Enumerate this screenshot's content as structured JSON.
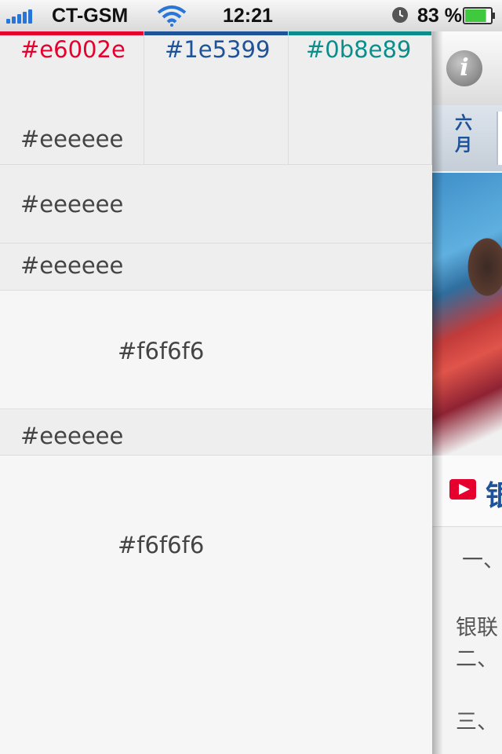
{
  "status_bar": {
    "carrier": "CT-GSM",
    "time": "12:21",
    "battery_percent": "83 %",
    "signal_bars": 5,
    "battery_level": 0.83
  },
  "menu": {
    "swatches": [
      {
        "label": "#e6002e",
        "color": "#e6002e"
      },
      {
        "label": "#1e5399",
        "color": "#1e5399"
      },
      {
        "label": "#0b8e89",
        "color": "#0b8e89"
      }
    ],
    "swatch_sub_label": "#eeeeee",
    "rows": [
      {
        "label": "#eeeeee"
      },
      {
        "label": "#eeeeee"
      },
      {
        "label": "#f6f6f6"
      },
      {
        "label": "#eeeeee"
      },
      {
        "label": "#f6f6f6"
      }
    ]
  },
  "background_app": {
    "info_icon_glyph": "i",
    "month_label_line1": "六",
    "month_label_line2": "月",
    "heading": "银",
    "body_lines": [
      "一、",
      "银联",
      "二、",
      "三、"
    ]
  },
  "colors": {
    "accent_red": "#e6002e",
    "accent_blue": "#1e5399",
    "accent_teal": "#0b8e89",
    "panel_gray": "#eeeeee",
    "panel_light": "#f6f6f6"
  }
}
